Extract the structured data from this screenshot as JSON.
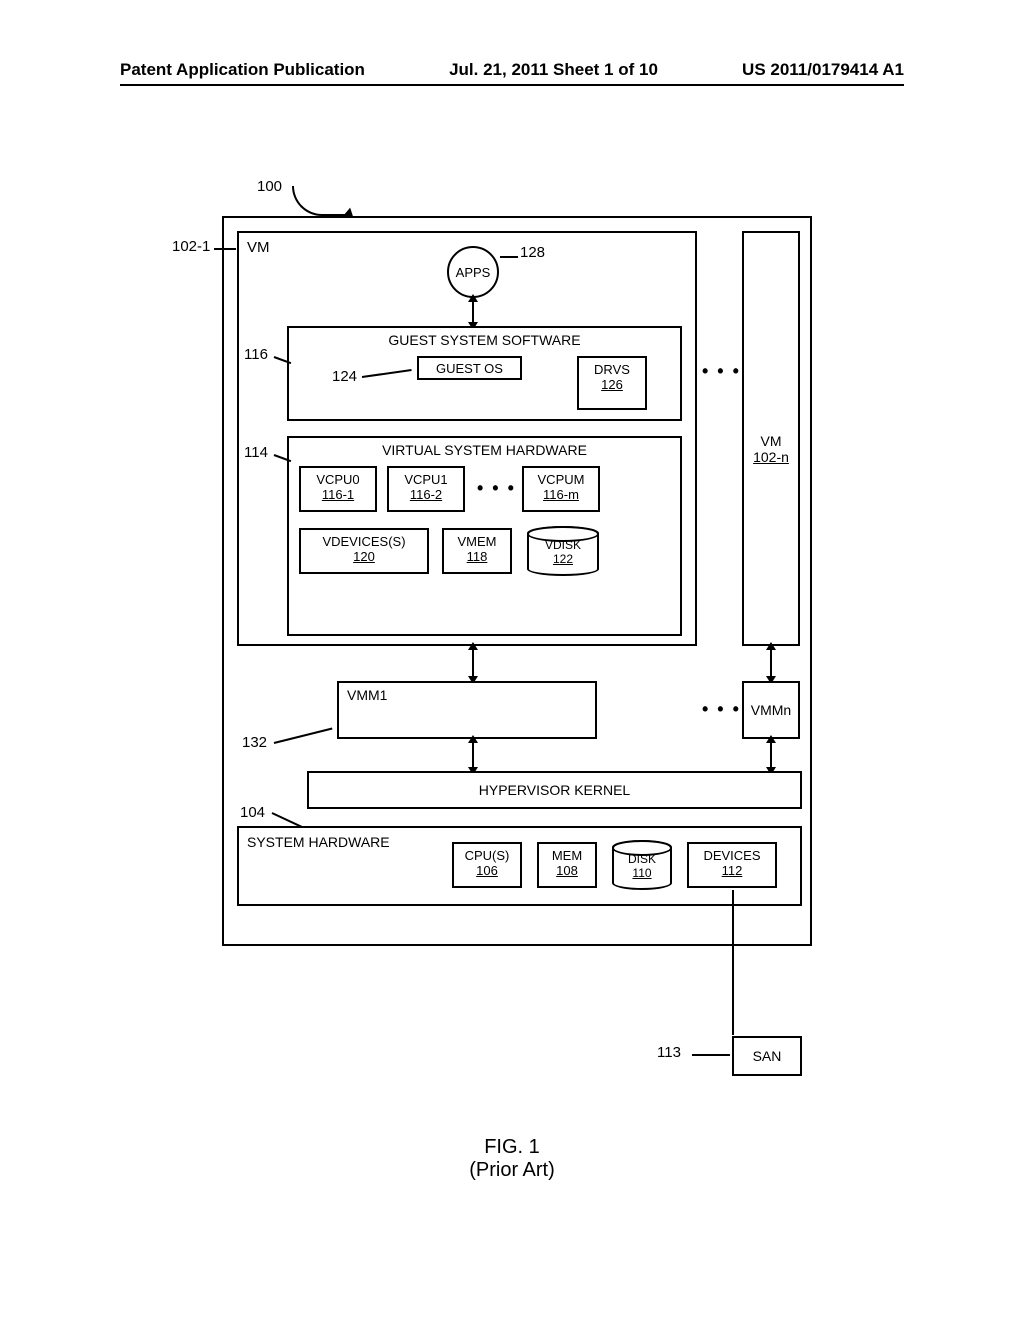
{
  "header": {
    "left": "Patent Application Publication",
    "center": "Jul. 21, 2011  Sheet 1 of 10",
    "right": "US 2011/0179414 A1"
  },
  "refs": {
    "r100": "100",
    "r102_1": "102-1",
    "r116": "116",
    "r124": "124",
    "r114": "114",
    "r128": "128",
    "r132": "132",
    "r104": "104",
    "r113": "113"
  },
  "vm": {
    "title": "VM",
    "apps": "APPS",
    "gss": {
      "title": "GUEST SYSTEM SOFTWARE",
      "guestos": "GUEST OS",
      "drvs": "DRVS",
      "drvs_num": "126"
    },
    "vsh": {
      "title": "VIRTUAL SYSTEM HARDWARE",
      "vcpu0": "VCPU0",
      "vcpu0_num": "116-1",
      "vcpu1": "VCPU1",
      "vcpu1_num": "116-2",
      "vcpum": "VCPUM",
      "vcpum_num": "116-m",
      "vdev": "VDEVICES(S)",
      "vdev_num": "120",
      "vmem": "VMEM",
      "vmem_num": "118",
      "vdisk": "VDISK",
      "vdisk_num": "122"
    }
  },
  "vmn": {
    "label": "VM",
    "num": "102-n"
  },
  "vmm1": "VMM1",
  "vmmn": "VMMn",
  "hypervisor": "HYPERVISOR KERNEL",
  "syshw": {
    "title": "SYSTEM HARDWARE",
    "cpus": "CPU(S)",
    "cpus_num": "106",
    "mem": "MEM",
    "mem_num": "108",
    "disk": "DISK",
    "disk_num": "110",
    "devices": "DEVICES",
    "devices_num": "112"
  },
  "san": "SAN",
  "dots": "• • •",
  "figure": {
    "num": "FIG. 1",
    "sub": "(Prior Art)"
  }
}
